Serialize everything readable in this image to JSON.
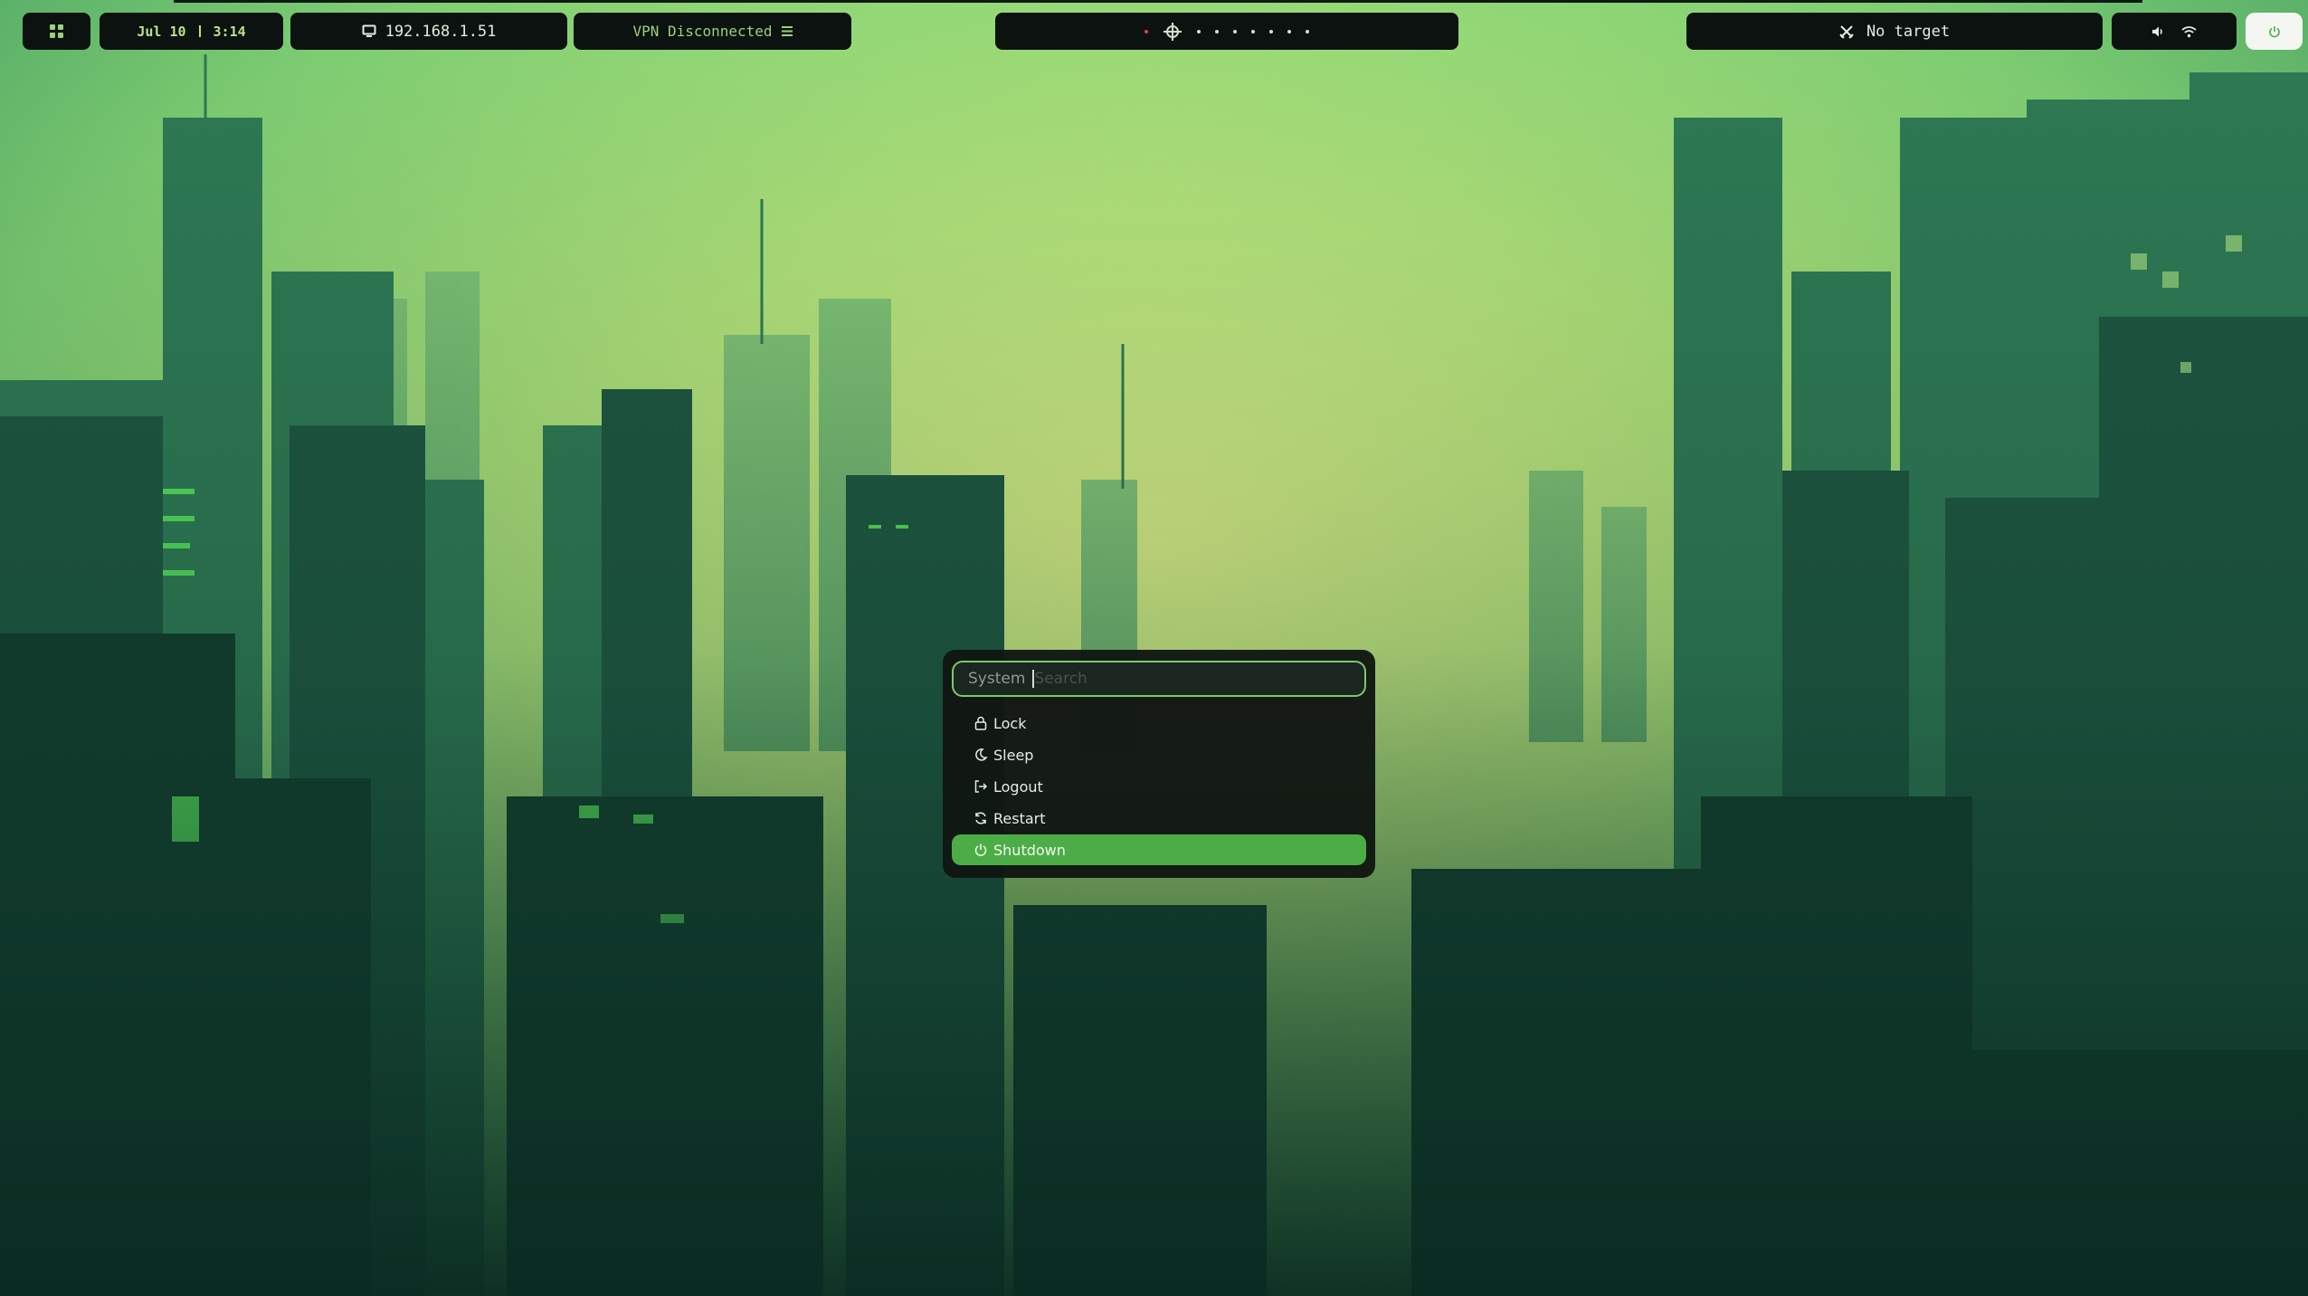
{
  "topbar": {
    "date": "Jul 10",
    "time": "3:14",
    "ip_address": "192.168.1.51",
    "vpn_status": "VPN Disconnected",
    "target_status": "No target",
    "workspace_count": 8,
    "icons": {
      "launcher": "grid-icon",
      "ip": "monitor-icon",
      "vpn": "menu-lines-icon",
      "target": "crossed-swords-icon",
      "volume": "speaker-icon",
      "wifi": "wifi-icon",
      "power": "power-icon"
    }
  },
  "power_menu": {
    "search_prefix": "System",
    "search_placeholder": "Search",
    "items": [
      {
        "label": "Lock",
        "icon": "lock-icon"
      },
      {
        "label": "Sleep",
        "icon": "moon-icon"
      },
      {
        "label": "Logout",
        "icon": "logout-icon"
      },
      {
        "label": "Restart",
        "icon": "restart-icon"
      },
      {
        "label": "Shutdown",
        "icon": "power-icon",
        "selected": true
      }
    ]
  },
  "colors": {
    "accent": "#4cad46",
    "bar_bg": "#0c120f",
    "menu_bg": "#111612",
    "date_text": "#b9e28d",
    "vpn_text": "#9ccf7c",
    "urgent_dot": "#e0443a"
  }
}
